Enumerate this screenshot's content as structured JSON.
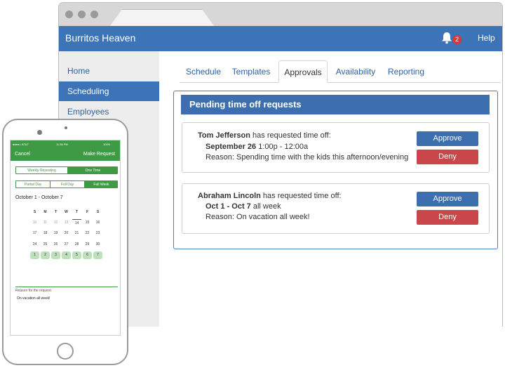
{
  "app": {
    "title": "Burritos Heaven",
    "notifications_count": "2",
    "help_label": "Help"
  },
  "sidebar": {
    "items": [
      {
        "label": "Home"
      },
      {
        "label": "Scheduling"
      },
      {
        "label": "Employees"
      }
    ]
  },
  "tabs": [
    {
      "label": "Schedule"
    },
    {
      "label": "Templates"
    },
    {
      "label": "Approvals"
    },
    {
      "label": "Availability"
    },
    {
      "label": "Reporting"
    }
  ],
  "panel": {
    "title": "Pending time off requests",
    "requests": [
      {
        "name": "Tom Jefferson",
        "action": " has requested time off:",
        "date": "September 26",
        "time": " 1:00p - 12:00a",
        "reason": "Reason: Spending time with the kids this afternoon/evening",
        "approve": "Approve",
        "deny": "Deny"
      },
      {
        "name": "Abraham Lincoln",
        "action": " has requested time off:",
        "date": "Oct 1 - Oct 7",
        "time": " all week",
        "reason": "Reason: On vacation all week!",
        "approve": "Approve",
        "deny": "Deny"
      }
    ]
  },
  "phone": {
    "status": {
      "carrier": "●●●●○ AT&T",
      "time": "11:36 PM",
      "battery": "100%"
    },
    "nav": {
      "cancel": "Cancel",
      "title": "Make Request"
    },
    "repeat_options": [
      {
        "label": "Weekly Repeating"
      },
      {
        "label": "One Time"
      }
    ],
    "duration_options": [
      {
        "label": "Partial Day"
      },
      {
        "label": "Full Day"
      },
      {
        "label": "Full Week"
      }
    ],
    "range": "October 1 - October 7",
    "dow": [
      "S",
      "M",
      "T",
      "W",
      "T",
      "F",
      "S"
    ],
    "weeks": [
      [
        "10",
        "11",
        "12",
        "13",
        "14",
        "15",
        "16"
      ],
      [
        "17",
        "18",
        "19",
        "20",
        "21",
        "22",
        "23"
      ],
      [
        "24",
        "25",
        "26",
        "27",
        "28",
        "29",
        "30"
      ],
      [
        "1",
        "2",
        "3",
        "4",
        "5",
        "6",
        "7"
      ]
    ],
    "reason_label": "Reason for the request",
    "reason_text": "On vacation all week!"
  },
  "colors": {
    "brand_blue": "#3d73b7",
    "approve_blue": "#3d6fae",
    "deny_red": "#c9464b",
    "phone_green": "#3e9a45",
    "chip_green": "#bfe0bd"
  }
}
